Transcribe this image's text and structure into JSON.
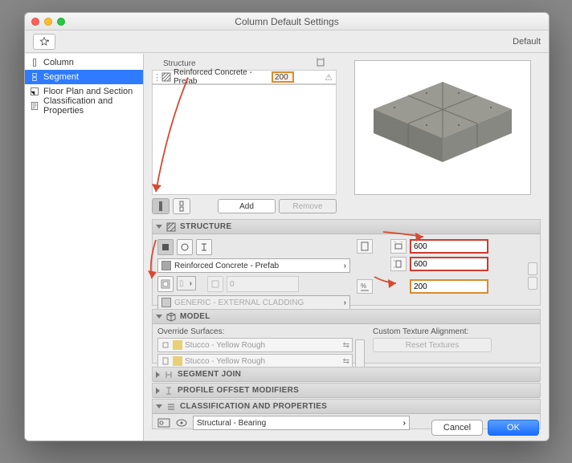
{
  "window": {
    "title": "Column Default Settings",
    "favorites_label": "Default"
  },
  "sidebar": {
    "items": [
      {
        "label": "Column"
      },
      {
        "label": "Segment"
      },
      {
        "label": "Floor Plan and Section"
      },
      {
        "label": "Classification and Properties"
      }
    ],
    "selected_index": 1
  },
  "segment_table": {
    "header": {
      "structure": "Structure",
      "dim_icon": "square-dim"
    },
    "rows": [
      {
        "name": "Reinforced Concrete - Prefab",
        "value": "200",
        "bell": "alert-off"
      }
    ],
    "toggles": {
      "simple": "column-simple-icon",
      "multi": "column-multi-icon"
    },
    "add": "Add",
    "remove": "Remove"
  },
  "preview": {
    "alt": "Prefab concrete slab 2x2"
  },
  "structure": {
    "title": "STRUCTURE",
    "shape_icons": [
      "square-filled",
      "circle-outline",
      "ibeam"
    ],
    "material": "Reinforced Concrete - Prefab",
    "veneer_material": "GENERIC - EXTERNAL CLADDING",
    "dims": {
      "width": "600",
      "depth": "600",
      "offset": "200"
    },
    "dim_icons": {
      "plan": "plan-icon",
      "width": "width-icon",
      "depth": "depth-icon",
      "pct": "percent-offset-icon"
    }
  },
  "model": {
    "title": "MODEL",
    "override": "Override Surfaces:",
    "surfaces": [
      "Stucco - Yellow Rough",
      "Stucco - Yellow Rough"
    ],
    "custom": "Custom Texture Alignment:",
    "reset": "Reset Textures"
  },
  "segment_join": {
    "title": "SEGMENT JOIN"
  },
  "profile_mod": {
    "title": "PROFILE OFFSET MODIFIERS"
  },
  "cls_prop": {
    "title": "CLASSIFICATION AND PROPERTIES",
    "value": "Structural - Bearing"
  },
  "footer": {
    "cancel": "Cancel",
    "ok": "OK"
  },
  "swatch_value": "0"
}
